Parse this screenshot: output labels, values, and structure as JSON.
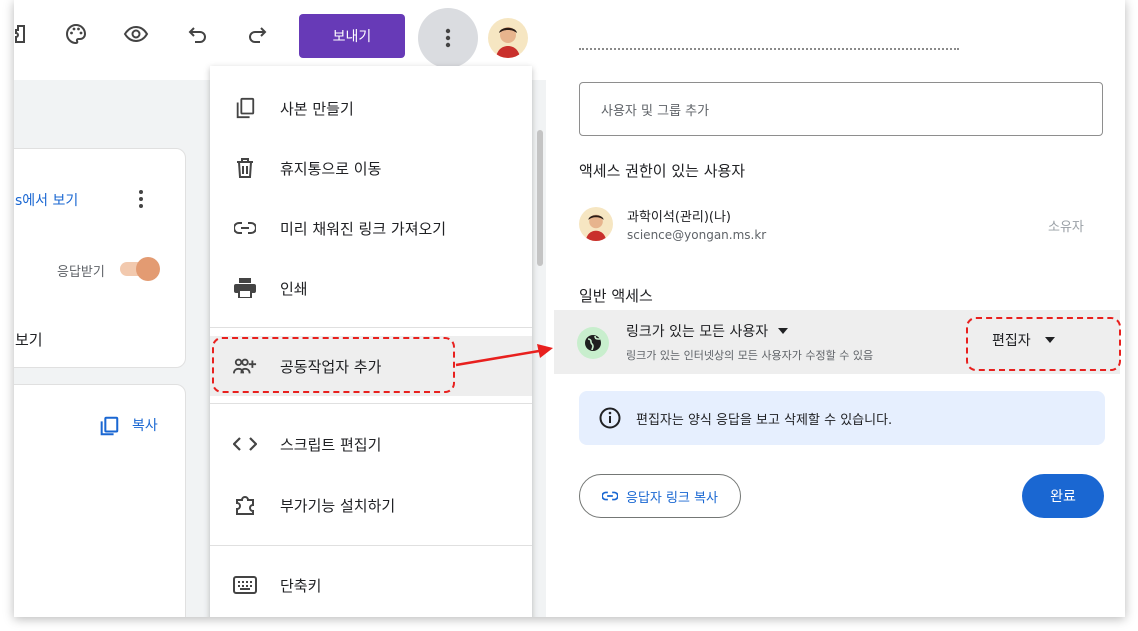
{
  "toolbar": {
    "icons": [
      "addon-icon",
      "palette-icon",
      "preview-eye-icon",
      "undo-icon",
      "redo-icon",
      "more-vert-icon"
    ],
    "send_label": "보내기"
  },
  "background_card": {
    "view_link": "s에서 보기",
    "accepting_label": "응답받기",
    "view_label": "보기",
    "copy_label": "복사",
    "toggle_on": true
  },
  "menu": {
    "items": [
      {
        "icon": "copy-icon",
        "label": "사본 만들기"
      },
      {
        "icon": "trash-icon",
        "label": "휴지통으로 이동"
      },
      {
        "icon": "link-icon",
        "label": "미리 채워진 링크 가져오기"
      },
      {
        "icon": "printer-icon",
        "label": "인쇄"
      },
      {
        "icon": "person-add-icon",
        "label": "공동작업자 추가"
      },
      {
        "icon": "code-icon",
        "label": "스크립트 편집기"
      },
      {
        "icon": "puzzle-icon",
        "label": "부가기능 설치하기"
      },
      {
        "icon": "keyboard-icon",
        "label": "단축키"
      }
    ]
  },
  "share": {
    "add_placeholder": "사용자 및 그룹 추가",
    "access_title": "액세스 권한이 있는 사용자",
    "owner": {
      "name": "과학이석(관리)(나)",
      "email": "science@yongan.ms.kr",
      "role": "소유자"
    },
    "general_title": "일반 액세스",
    "general": {
      "scope": "링크가 있는 모든 사용자",
      "desc": "링크가 있는 인터넷상의 모든 사용자가 수정할 수 있음",
      "role": "편집자"
    },
    "info": "편집자는 양식 응답을 보고 삭제할 수 있습니다.",
    "copy_link": "응답자 링크 복사",
    "done": "완료"
  },
  "colors": {
    "send_purple": "#673ab7",
    "blue": "#1a67d2",
    "annotation_red": "#e8201e",
    "info_bg": "#e6effe",
    "globe_bg": "#c8eecd"
  }
}
